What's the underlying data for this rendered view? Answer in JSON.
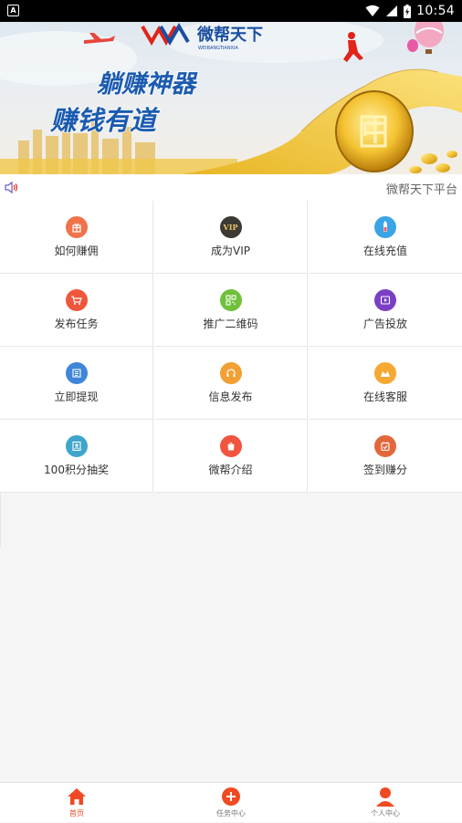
{
  "status_bar": {
    "indicator": "A",
    "time": "10:54"
  },
  "banner": {
    "brand_cn": "微帮天下",
    "brand_en": "WEIBANGTIANXIA",
    "slogan_line1": "躺赚神器",
    "slogan_line2": "赚钱有道",
    "coin_char": "中"
  },
  "ticker": {
    "text": "微帮天下平台"
  },
  "grid": {
    "items": [
      {
        "label": "如何赚佣",
        "icon": "gift-icon",
        "color": "#f0734b"
      },
      {
        "label": "成为VIP",
        "icon": "vip-icon",
        "color": "#3d3a33"
      },
      {
        "label": "在线充值",
        "icon": "recharge-icon",
        "color": "#3aa4e6"
      },
      {
        "label": "发布任务",
        "icon": "cart-icon",
        "color": "#f0563c"
      },
      {
        "label": "推广二维码",
        "icon": "qrcode-icon",
        "color": "#6fc13b"
      },
      {
        "label": "广告投放",
        "icon": "video-icon",
        "color": "#7b3fc4"
      },
      {
        "label": "立即提现",
        "icon": "withdraw-icon",
        "color": "#3f86d9"
      },
      {
        "label": "信息发布",
        "icon": "headset-icon",
        "color": "#f2a033"
      },
      {
        "label": "在线客服",
        "icon": "service-icon",
        "color": "#f7a832"
      },
      {
        "label": "100积分抽奖",
        "icon": "lottery-icon",
        "color": "#3ea6cc"
      },
      {
        "label": "微帮介绍",
        "icon": "intro-icon",
        "color": "#f1543f"
      },
      {
        "label": "签到赚分",
        "icon": "checkin-icon",
        "color": "#e2683c"
      }
    ]
  },
  "bottom_nav": {
    "items": [
      {
        "label": "首页",
        "icon": "home-icon",
        "active": true
      },
      {
        "label": "任务中心",
        "icon": "task-add-icon",
        "active": false
      },
      {
        "label": "个人中心",
        "icon": "person-icon",
        "active": false
      }
    ],
    "active_color": "#ef4a23"
  }
}
